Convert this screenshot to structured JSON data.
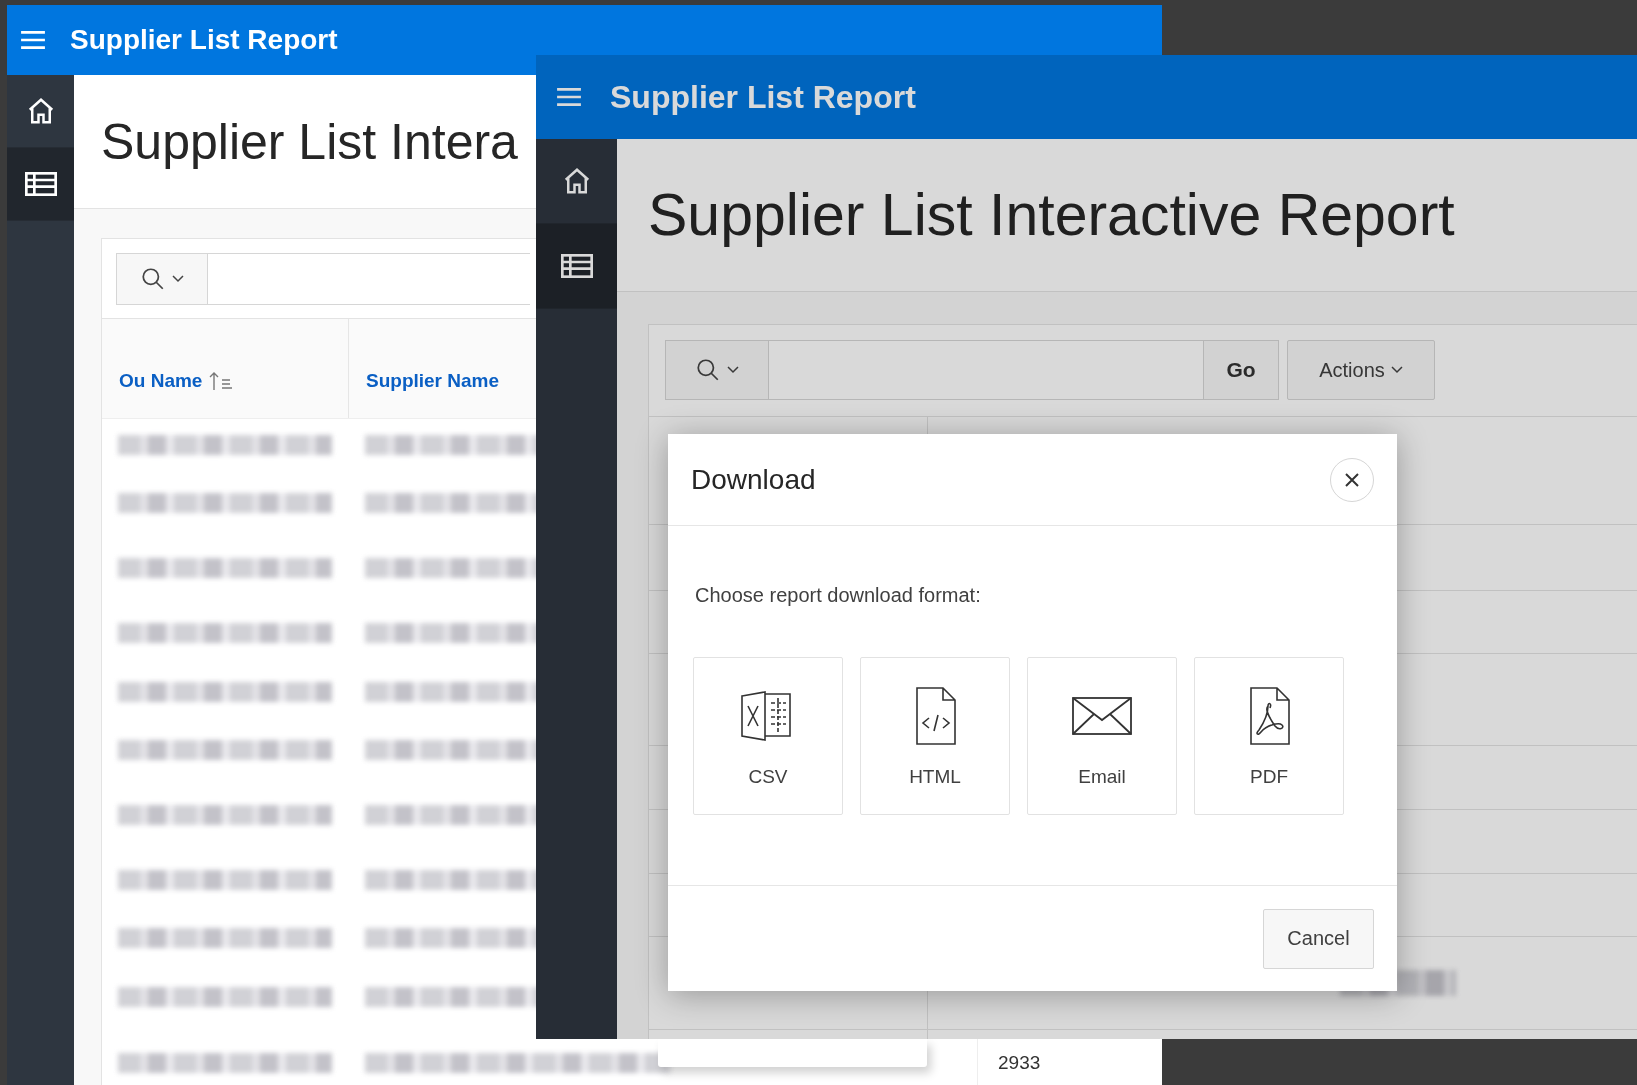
{
  "back_window": {
    "header_title": "Supplier List Report",
    "sidebar": [
      {
        "kind": "home",
        "selected": false
      },
      {
        "kind": "table",
        "selected": true
      }
    ],
    "page_title": "Supplier List Intera",
    "columns": [
      {
        "label": "Ou Name",
        "sorted": true
      },
      {
        "label": "Supplier Name",
        "sorted": false
      }
    ],
    "last_row_cell": "2933"
  },
  "front_window": {
    "header_title": "Supplier List Report",
    "sidebar": [
      {
        "kind": "home",
        "selected": false
      },
      {
        "kind": "table",
        "selected": true
      }
    ],
    "page_title": "Supplier List Interactive Report",
    "go_button": "Go",
    "actions_button": "Actions",
    "dialog": {
      "title": "Download",
      "prompt": "Choose report download format:",
      "formats": [
        {
          "label": "CSV",
          "kind": "csv"
        },
        {
          "label": "HTML",
          "kind": "html"
        },
        {
          "label": "Email",
          "kind": "email"
        },
        {
          "label": "PDF",
          "kind": "pdf"
        }
      ],
      "cancel_button": "Cancel"
    }
  }
}
